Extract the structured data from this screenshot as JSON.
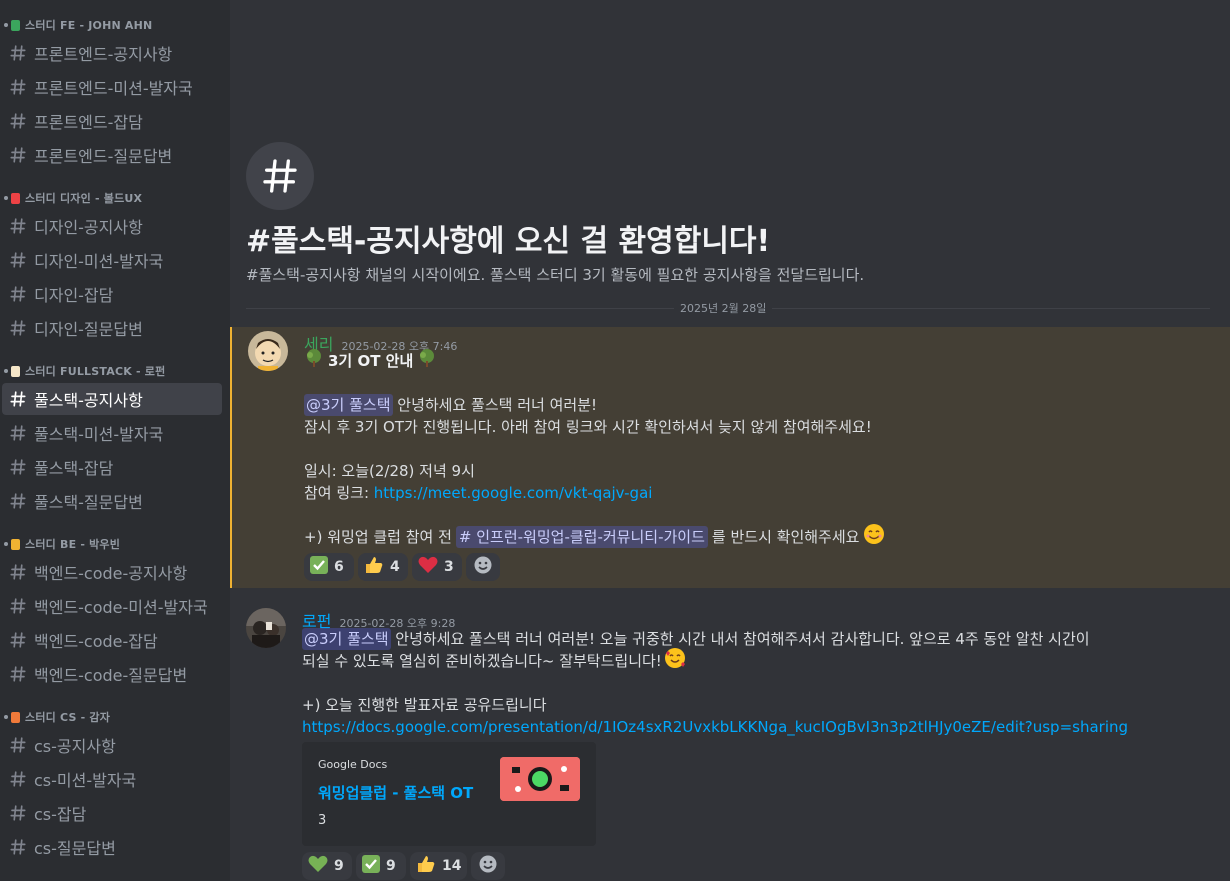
{
  "sidebar": {
    "categories": [
      {
        "label": "스터디 FE - JOHN AHN",
        "color": "#3ba55d",
        "channels": [
          "프론트엔드-공지사항",
          "프론트엔드-미션-발자국",
          "프론트엔드-잡담",
          "프론트엔드-질문답변"
        ]
      },
      {
        "label": "스터디 디자인 - 볼드UX",
        "color": "#ed4245",
        "channels": [
          "디자인-공지사항",
          "디자인-미션-발자국",
          "디자인-잡담",
          "디자인-질문답변"
        ]
      },
      {
        "label": "스터디 FULLSTACK - 로펀",
        "color": "#f5e6c8",
        "channels": [
          "풀스택-공지사항",
          "풀스택-미션-발자국",
          "풀스택-잡담",
          "풀스택-질문답변"
        ]
      },
      {
        "label": "스터디 BE - 박우빈",
        "color": "#f0b232",
        "channels": [
          "백엔드-code-공지사항",
          "백엔드-code-미션-발자국",
          "백엔드-code-잡담",
          "백엔드-code-질문답변"
        ]
      },
      {
        "label": "스터디 CS - 감자",
        "color": "#f07a3a",
        "channels": [
          "cs-공지사항",
          "cs-미션-발자국",
          "cs-잡담",
          "cs-질문답변"
        ]
      }
    ],
    "active_channel": "풀스택-공지사항"
  },
  "welcome": {
    "title": "#풀스택-공지사항에 오신 걸 환영합니다!",
    "subtitle": "#풀스택-공지사항 채널의 시작이에요. 풀스택 스터디 3기 활동에 필요한 공지사항을 전달드립니다."
  },
  "date_divider": "2025년 2월 28일",
  "messages": [
    {
      "author": "세리",
      "author_color": "#3ba55d",
      "timestamp": "2025-02-28 오후 7:46",
      "title": "3기 OT 안내",
      "mention": "@3기 풀스택",
      "line1_text": " 안녕하세요 풀스택 러너 여러분!",
      "line2": "잠시 후 3기 OT가 진행됩니다. 아래 참여 링크와 시간 확인하셔서 늦지 않게 참여해주세요!",
      "line3": "일시: 오늘(2/28) 저녁 9시",
      "line4_label": "참여 링크: ",
      "line4_link": "https://meet.google.com/vkt-qajv-gai",
      "line5_pre": "+) 워밍업 클럽 참여 전",
      "line5_channel": "# 인프런-워밍업-클럽-커뮤니티-가이드",
      "line5_post": "를 반드시 확인해주세요",
      "reactions": [
        {
          "icon": "check-mark-icon",
          "count": "6"
        },
        {
          "icon": "thumbs-up-icon",
          "count": "4"
        },
        {
          "icon": "heart-icon",
          "count": "3"
        }
      ]
    },
    {
      "author": "로펀",
      "author_color": "#00a8fc",
      "timestamp": "2025-02-28 오후 9:28",
      "mention": "@3기 풀스택",
      "line1_text": " 안녕하세요 풀스택 러너 여러분! 오늘 귀중한 시간 내서 참여해주셔서 감사합니다. 앞으로 4주 동안 알찬 시간이",
      "line2": "되실 수 있도록 열심히 준비하겠습니다~ 잘부탁드립니다!",
      "line3": "+) 오늘 진행한 발표자료 공유드립니다",
      "link": "https://docs.google.com/presentation/d/1IOz4sxR2UvxkbLKKNga_kucIOgBvI3n3p2tlHJy0eZE/edit?usp=sharing",
      "embed": {
        "provider": "Google Docs",
        "title": "워밍업클럽 - 풀스택 OT",
        "description": "3"
      },
      "reactions": [
        {
          "icon": "green-heart-icon",
          "count": "9"
        },
        {
          "icon": "check-mark-icon",
          "count": "9"
        },
        {
          "icon": "thumbs-up-icon",
          "count": "14"
        }
      ]
    }
  ]
}
